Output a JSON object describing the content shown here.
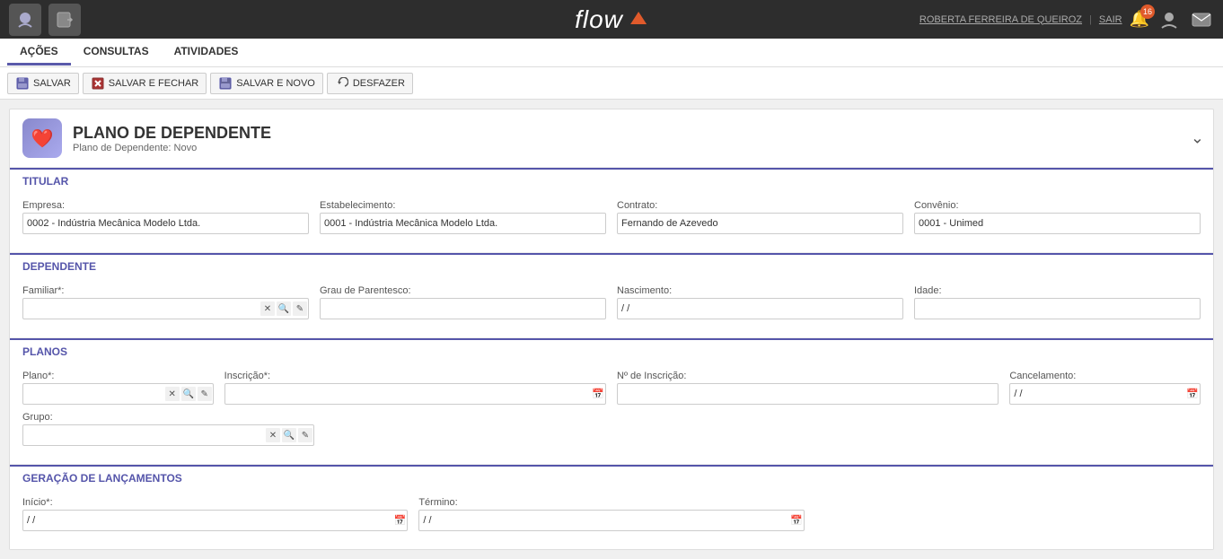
{
  "topbar": {
    "user": "ROBERTA FERREIRA DE QUEIROZ",
    "separator": "|",
    "sair": "SAIR",
    "badge_count": "16",
    "logo": "flow"
  },
  "menu": {
    "items": [
      {
        "label": "AÇÕES",
        "active": true
      },
      {
        "label": "CONSULTAS",
        "active": false
      },
      {
        "label": "ATIVIDADES",
        "active": false
      }
    ]
  },
  "toolbar": {
    "buttons": [
      {
        "label": "SALVAR",
        "icon": "💾"
      },
      {
        "label": "SALVAR E FECHAR",
        "icon": "💾"
      },
      {
        "label": "SALVAR E NOVO",
        "icon": "📄"
      },
      {
        "label": "DESFAZER",
        "icon": "↩"
      }
    ]
  },
  "form": {
    "title": "PLANO DE DEPENDENTE",
    "subtitle": "Plano de Dependente: Novo",
    "sections": {
      "titular": {
        "label": "TITULAR",
        "empresa_label": "Empresa:",
        "empresa_value": "0002 - Indústria Mecânica Modelo Ltda.",
        "estabelecimento_label": "Estabelecimento:",
        "estabelecimento_value": "0001 - Indústria Mecânica Modelo Ltda.",
        "contrato_label": "Contrato:",
        "contrato_value": "Fernando de Azevedo",
        "convenio_label": "Convênio:",
        "convenio_value": "0001 - Unimed"
      },
      "dependente": {
        "label": "DEPENDENTE",
        "familiar_label": "Familiar*:",
        "familiar_value": "",
        "grau_label": "Grau de Parentesco:",
        "grau_value": "",
        "nascimento_label": "Nascimento:",
        "nascimento_value": "/ /",
        "idade_label": "Idade:",
        "idade_value": ""
      },
      "planos": {
        "label": "PLANOS",
        "plano_label": "Plano*:",
        "plano_value": "",
        "inscricao_label": "Inscrição*:",
        "inscricao_value": "",
        "num_inscricao_label": "Nº de Inscrição:",
        "num_inscricao_value": "",
        "cancelamento_label": "Cancelamento:",
        "cancelamento_value": "/ /",
        "grupo_label": "Grupo:",
        "grupo_value": ""
      },
      "geracao": {
        "label": "GERAÇÃO DE LANÇAMENTOS",
        "inicio_label": "Início*:",
        "inicio_value": "/ /",
        "termino_label": "Término:",
        "termino_value": "/ /"
      }
    }
  }
}
